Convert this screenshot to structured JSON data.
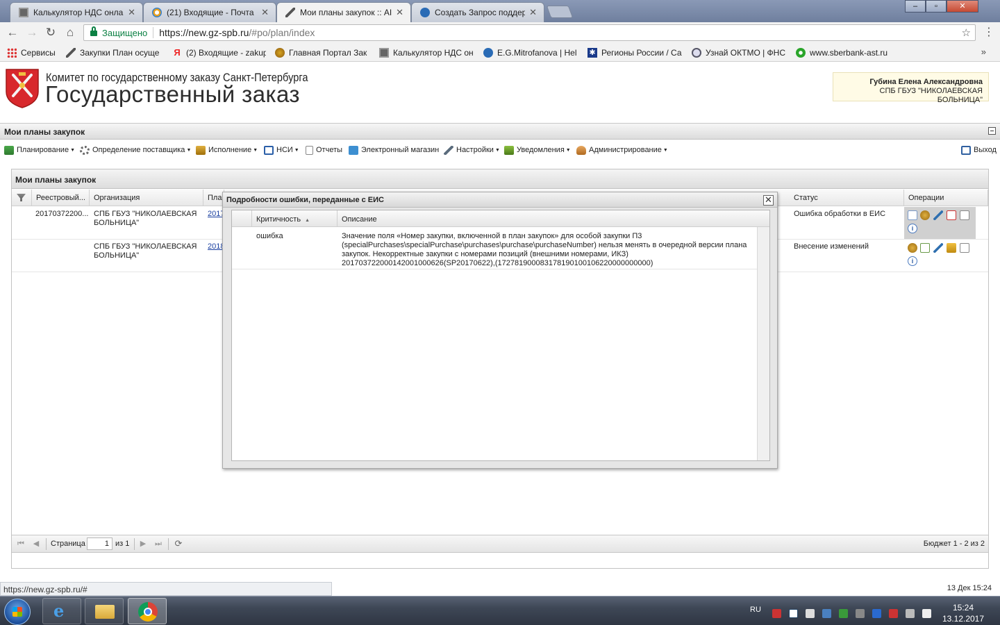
{
  "browser": {
    "tabs": [
      {
        "label": "Калькулятор НДС онлай",
        "icon": "calculator-icon",
        "active": false
      },
      {
        "label": "(21) Входящие - Почта I",
        "icon": "mail-icon",
        "active": false
      },
      {
        "label": "Мои планы закупок :: AI",
        "icon": "hammer-icon",
        "active": true
      },
      {
        "label": "Создать Запрос поддер",
        "icon": "support-icon",
        "active": false
      }
    ],
    "secure_label": "Защищено",
    "url_host": "https://new.gz-spb.ru",
    "url_rest": "/#po/plan/index",
    "bookmarks": [
      {
        "label": "Сервисы",
        "icon": "apps-grid-icon"
      },
      {
        "label": "Закупки План осуще",
        "icon": "hammer-icon"
      },
      {
        "label": "(2) Входящие - zakup",
        "icon": "yandex-icon"
      },
      {
        "label": "Главная Портал Зак",
        "icon": "eagle-emblem-icon"
      },
      {
        "label": "Калькулятор НДС он",
        "icon": "calculator-icon"
      },
      {
        "label": "E.G.Mitrofanova | Hel",
        "icon": "support-icon"
      },
      {
        "label": "Регионы России / Са",
        "icon": "snowflake-icon"
      },
      {
        "label": "Узнай ОКТМО | ФНС",
        "icon": "fns-icon"
      },
      {
        "label": "www.sberbank-ast.ru",
        "icon": "sberbank-icon"
      }
    ],
    "bookmarks_more": "»"
  },
  "header": {
    "org_subtitle": "Комитет по государственному заказу Санкт-Петербурга",
    "org_title": "Государственный заказ",
    "user_name": "Губина Елена Александровна",
    "user_org": "СПБ ГБУЗ \"НИКОЛАЕВСКАЯ БОЛЬНИЦА\""
  },
  "page_title": "Мои планы закупок",
  "menu": [
    {
      "label": "Планирование",
      "dropdown": true,
      "icon": "planning-icon",
      "color": "#3a8a3a"
    },
    {
      "label": "Определение поставщика",
      "dropdown": true,
      "icon": "gears-icon",
      "color": "#666666"
    },
    {
      "label": "Исполнение",
      "dropdown": true,
      "icon": "briefcase-icon",
      "color": "#b8860b"
    },
    {
      "label": "НСИ",
      "dropdown": true,
      "icon": "book-icon",
      "color": "#2b5fa8"
    },
    {
      "label": "Отчеты",
      "dropdown": false,
      "icon": "report-icon",
      "color": "#8a8a8a"
    },
    {
      "label": "Электронный магазин",
      "dropdown": false,
      "icon": "cart-icon",
      "color": "#3d8fd1"
    },
    {
      "label": "Настройки",
      "dropdown": true,
      "icon": "wrench-icon",
      "color": "#5a6b7c"
    },
    {
      "label": "Уведомления",
      "dropdown": true,
      "icon": "notification-icon",
      "color": "#6a9b2a"
    },
    {
      "label": "Администрирование",
      "dropdown": true,
      "icon": "admin-user-icon",
      "color": "#c07830"
    }
  ],
  "logout_label": "Выход",
  "grid": {
    "title": "Мои планы закупок",
    "columns": [
      "Реестровый...",
      "Организация",
      "Пла",
      "Статус",
      "Операции"
    ],
    "rows": [
      {
        "registry": "20170372200...",
        "org": "СПБ ГБУЗ \"НИКОЛАЕВСКАЯ БОЛЬНИЦА\"",
        "plan": "2017",
        "status": "Ошибка обработки в ЕИС"
      },
      {
        "registry": "",
        "org": "СПБ ГБУЗ \"НИКОЛАЕВСКАЯ БОЛЬНИЦА\"",
        "plan": "2018",
        "status": "Внесение изменений"
      }
    ],
    "pager": {
      "page_label": "Страница",
      "page_value": "1",
      "of_label": "из 1",
      "summary": "Бюджет 1 - 2 из 2"
    }
  },
  "modal": {
    "title": "Подробности ошибки, переданные с ЕИС",
    "columns": [
      "Критичность",
      "Описание"
    ],
    "rows": [
      {
        "severity": "ошибка",
        "description": "Значение поля «Номер закупки, включенной в план закупок» для особой закупки П3 (specialPurchases\\specialPurchase\\purchases\\purchase\\purchaseNumber) нельзя менять в очередной версии плана закупок. Некорректные закупки с номерами позиций (внешними номерами, ИКЗ) 201703722000142001000626(SP20170622),(172781900083178190100106220000000000)"
      }
    ]
  },
  "statusbar": {
    "url": "https://new.gz-spb.ru/#",
    "datetime": "13 Дек 15:24"
  },
  "taskbar": {
    "lang": "RU",
    "time": "15:24",
    "date": "13.12.2017"
  }
}
